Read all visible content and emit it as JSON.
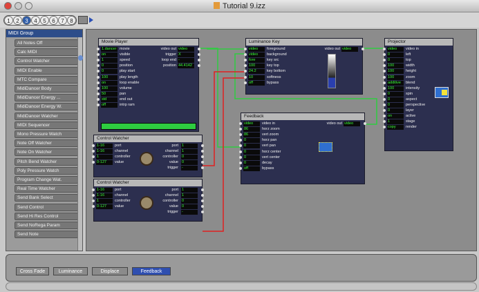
{
  "window": {
    "title": "Tutorial 9.izz"
  },
  "toolbar": {
    "scene_tabs": [
      "1",
      "2",
      "3",
      "4",
      "5",
      "6",
      "7",
      "8"
    ],
    "selected_tab": 2
  },
  "left_panel": {
    "header": "MIDI Group",
    "items": [
      "All Notes Off",
      "Calc MIDI",
      "Control Watcher",
      "MIDI Enable",
      "MTC Compare",
      "MidiDancer Body",
      "MidiDancer Energy ...",
      "MidiDancer Energy W.",
      "MidiDancer Watcher",
      "MIDI Sequencer",
      "Mono Pressure Watch",
      "Note Off Watcher",
      "Note On Watcher",
      "Pitch Bend Watcher",
      "Poly Pressure Watch",
      "Program Change Wat.",
      "Real Time Watcher",
      "Send Bank Select",
      "Send Control",
      "Send Hi Res Control",
      "Send NoRega Param",
      "Send Note"
    ]
  },
  "actors": {
    "movie_player": {
      "title": "Movie Player",
      "inputs": [
        {
          "value": "1.dancer",
          "label": "movie"
        },
        {
          "value": "on",
          "label": "visible"
        },
        {
          "value": "1",
          "label": "speed"
        },
        {
          "value": "0",
          "label": "position"
        },
        {
          "value": "0",
          "label": "play start"
        },
        {
          "value": "100",
          "label": "play length"
        },
        {
          "value": "on",
          "label": "loop enable"
        },
        {
          "value": "100",
          "label": "volume"
        },
        {
          "value": "50",
          "label": "pan"
        },
        {
          "value": "std",
          "label": "end out"
        },
        {
          "value": "off",
          "label": "intrp ram"
        }
      ],
      "outputs": [
        {
          "label": "video out",
          "value": "video"
        },
        {
          "label": "trigger",
          "value": "X"
        },
        {
          "label": "loop end",
          "value": "-"
        },
        {
          "label": "position",
          "value": "44.4142"
        }
      ]
    },
    "luminance_key": {
      "title": "Luminance Key",
      "inputs": [
        {
          "value": "video",
          "label": "foreground"
        },
        {
          "value": "video",
          "label": "background"
        },
        {
          "value": "fore",
          "label": "key src"
        },
        {
          "value": "100",
          "label": "key top"
        },
        {
          "value": "24.2",
          "label": "key bottom"
        },
        {
          "value": "10",
          "label": "softness"
        },
        {
          "value": "off",
          "label": "bypass"
        }
      ],
      "outputs": [
        {
          "label": "video out",
          "value": "video"
        }
      ]
    },
    "projector": {
      "title": "Projector",
      "inputs": [
        {
          "value": "video",
          "label": "video in"
        },
        {
          "value": "0",
          "label": "left"
        },
        {
          "value": "0",
          "label": "top"
        },
        {
          "value": "100",
          "label": "width"
        },
        {
          "value": "100",
          "label": "height"
        },
        {
          "value": "100",
          "label": "zoom"
        },
        {
          "value": "additive",
          "label": "blend"
        },
        {
          "value": "100",
          "label": "intensity"
        },
        {
          "value": "0",
          "label": "spin"
        },
        {
          "value": "0",
          "label": "aspect"
        },
        {
          "value": "0",
          "label": "perspective"
        },
        {
          "value": "0",
          "label": "layer"
        },
        {
          "value": "on",
          "label": "active"
        },
        {
          "value": "1",
          "label": "stage"
        },
        {
          "value": "copy",
          "label": "render"
        }
      ]
    },
    "feedback": {
      "title": "Feedback",
      "inputs": [
        {
          "value": "video",
          "label": "video in"
        },
        {
          "value": "86",
          "label": "horz zoom"
        },
        {
          "value": "86",
          "label": "vert zoom"
        },
        {
          "value": "0",
          "label": "horz pan"
        },
        {
          "value": "0",
          "label": "vert pan"
        },
        {
          "value": "0",
          "label": "horz center"
        },
        {
          "value": "0",
          "label": "vert center"
        },
        {
          "value": "0",
          "label": "decay"
        },
        {
          "value": "off",
          "label": "bypass"
        }
      ],
      "outputs": [
        {
          "label": "video out",
          "value": "video"
        }
      ]
    },
    "control_watcher_1": {
      "title": "Control Watcher",
      "inputs": [
        {
          "value": "1-16",
          "label": "port"
        },
        {
          "value": "1-16",
          "label": "channel"
        },
        {
          "value": "1",
          "label": "controller"
        },
        {
          "value": "0-127",
          "label": "value"
        }
      ],
      "outputs": [
        {
          "label": "port",
          "value": "1"
        },
        {
          "label": "channel",
          "value": "1"
        },
        {
          "label": "controller",
          "value": "0"
        },
        {
          "label": "value",
          "value": "0"
        },
        {
          "label": "trigger",
          "value": "-"
        }
      ]
    },
    "control_watcher_2": {
      "title": "Control Watcher",
      "inputs": [
        {
          "value": "1-16",
          "label": "port"
        },
        {
          "value": "1-16",
          "label": "channel"
        },
        {
          "value": "1",
          "label": "controller"
        },
        {
          "value": "0-127",
          "label": "value"
        }
      ],
      "outputs": [
        {
          "label": "port",
          "value": "1"
        },
        {
          "label": "channel",
          "value": "1"
        },
        {
          "label": "controller",
          "value": "0"
        },
        {
          "label": "value",
          "value": "0"
        },
        {
          "label": "trigger",
          "value": "-"
        }
      ]
    }
  },
  "scenes": [
    {
      "label": "Cross Fade"
    },
    {
      "label": "Luminance"
    },
    {
      "label": "Displace"
    },
    {
      "label": "Feedback"
    }
  ],
  "selected_scene": "Feedback",
  "colors": {
    "link_green": "#2ecc40",
    "link_red": "#e02020",
    "accent": "#2f4fb0"
  }
}
